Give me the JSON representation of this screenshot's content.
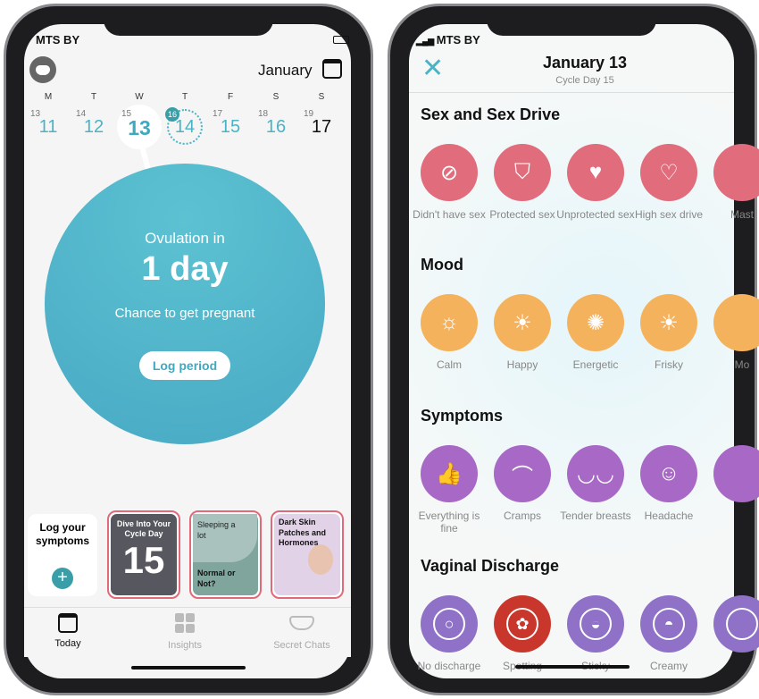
{
  "left": {
    "status": {
      "carrier": "MTS BY"
    },
    "header": {
      "month": "January"
    },
    "week": {
      "days": [
        {
          "dow": "M",
          "cycle": "13",
          "date": "11"
        },
        {
          "dow": "T",
          "cycle": "14",
          "date": "12"
        },
        {
          "dow": "W",
          "cycle": "15",
          "date": "13"
        },
        {
          "dow": "T",
          "cycle": "16",
          "date": "14"
        },
        {
          "dow": "F",
          "cycle": "17",
          "date": "15"
        },
        {
          "dow": "S",
          "cycle": "18",
          "date": "16"
        },
        {
          "dow": "S",
          "cycle": "19",
          "date": "17"
        }
      ]
    },
    "main": {
      "line1": "Ovulation in",
      "line2": "1 day",
      "line3": "Chance to get pregnant",
      "button": "Log period"
    },
    "cards": {
      "log": "Log your symptoms",
      "c1_title": "Dive Into Your Cycle Day",
      "c1_num": "15",
      "c2_top": "Sleeping a lot",
      "c2_bottom": "Normal or Not?",
      "c3_title": "Dark Skin Patches and Hormones"
    },
    "tabs": [
      {
        "label": "Today"
      },
      {
        "label": "Insights"
      },
      {
        "label": "Secret Chats"
      }
    ]
  },
  "right": {
    "status": {
      "carrier": "MTS BY"
    },
    "header": {
      "title": "January 13",
      "subtitle": "Cycle Day 15"
    },
    "sections": [
      {
        "title": "Sex and Sex Drive",
        "color": "#e06c7c",
        "items": [
          "Didn't have sex",
          "Protected sex",
          "Unprotected sex",
          "High sex drive",
          "Mast"
        ]
      },
      {
        "title": "Mood",
        "color": "#f5b25c",
        "items": [
          "Calm",
          "Happy",
          "Energetic",
          "Frisky",
          "Mo"
        ]
      },
      {
        "title": "Symptoms",
        "color": "#a768c6",
        "items": [
          "Everything is fine",
          "Cramps",
          "Tender breasts",
          "Headache",
          ""
        ]
      },
      {
        "title": "Vaginal Discharge",
        "color": "#8f72c8",
        "items": [
          "No discharge",
          "Spotting",
          "Sticky",
          "Creamy",
          ""
        ]
      }
    ],
    "spotting_color": "#c9372c"
  },
  "colors": {
    "accent": "#4ab3c6"
  }
}
